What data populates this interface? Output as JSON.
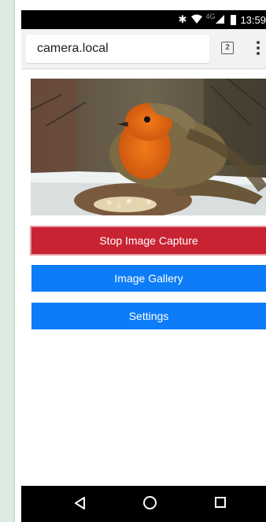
{
  "status_bar": {
    "time": "13:59",
    "network": "4G",
    "icons": [
      "bluetooth-icon",
      "wifi-icon",
      "signal-icon",
      "battery-icon"
    ]
  },
  "browser": {
    "url": "camera.local",
    "tab_count": "2",
    "menu_icon": "more-vert-icon"
  },
  "page": {
    "camera_image": "robin-on-feeder",
    "buttons": {
      "stop_capture": "Stop Image Capture",
      "gallery": "Image Gallery",
      "settings": "Settings"
    },
    "colors": {
      "stop": "#c82333",
      "primary": "#0d7df7"
    }
  },
  "nav_bar": {
    "icons": [
      "back-icon",
      "home-icon",
      "recents-icon"
    ]
  }
}
